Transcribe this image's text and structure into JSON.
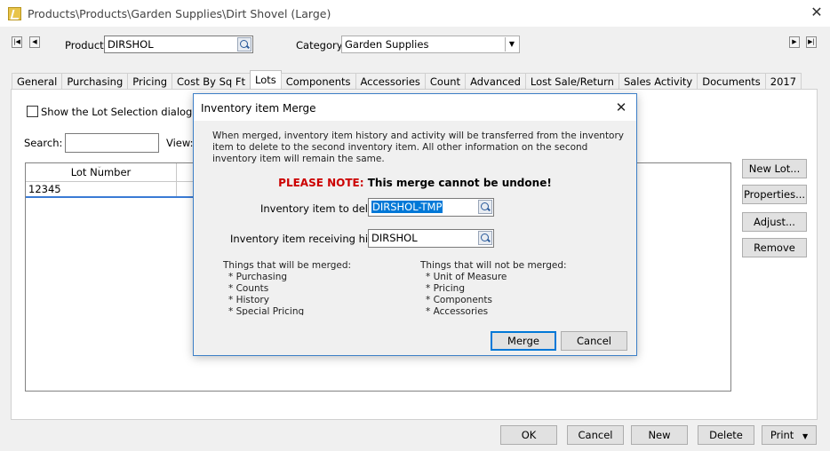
{
  "window": {
    "title": "Products\\Products\\Garden Supplies\\Dirt Shovel (Large)"
  },
  "header": {
    "product_label": "Product:",
    "product_value": "DIRSHOL",
    "category_label": "Category:",
    "category_value": "Garden Supplies"
  },
  "tabs": [
    {
      "label": "General"
    },
    {
      "label": "Purchasing"
    },
    {
      "label": "Pricing"
    },
    {
      "label": "Cost By Sq Ft"
    },
    {
      "label": "Lots"
    },
    {
      "label": "Components"
    },
    {
      "label": "Accessories"
    },
    {
      "label": "Count"
    },
    {
      "label": "Advanced"
    },
    {
      "label": "Lost Sale/Return"
    },
    {
      "label": "Sales Activity"
    },
    {
      "label": "Documents"
    },
    {
      "label": "2017"
    }
  ],
  "active_tab": "Lots",
  "lots": {
    "show_dialog_label": "Show the Lot Selection dialog while",
    "search_label": "Search:",
    "search_value": "",
    "view_label": "View:",
    "column_header": "Lot Number",
    "rows": [
      {
        "lot_number": "12345"
      }
    ],
    "buttons": {
      "new_lot": "New Lot...",
      "properties": "Properties...",
      "adjust": "Adjust...",
      "remove": "Remove"
    }
  },
  "footer": {
    "ok": "OK",
    "cancel": "Cancel",
    "new": "New",
    "delete": "Delete",
    "print": "Print"
  },
  "dialog": {
    "title": "Inventory item Merge",
    "description": "When merged, inventory item history and activity will be transferred from the inventory item to delete to the second inventory item. All other information on the second inventory item will remain the same.",
    "note_label": "PLEASE NOTE:",
    "note_text": "This merge cannot be undone!",
    "delete_label": "Inventory item to delete:",
    "delete_value": "DIRSHOL-TMP",
    "receive_label": "Inventory item receiving history:",
    "receive_value": "DIRSHOL",
    "merged_heading": "Things that will be merged:",
    "merged_items": [
      "* Purchasing",
      "* Counts",
      "* History",
      "* Special Pricing"
    ],
    "not_merged_heading": "Things that will not be merged:",
    "not_merged_items": [
      "* Unit of Measure",
      "* Pricing",
      "* Components",
      "* Accessories"
    ],
    "merge_button": "Merge",
    "cancel_button": "Cancel"
  }
}
